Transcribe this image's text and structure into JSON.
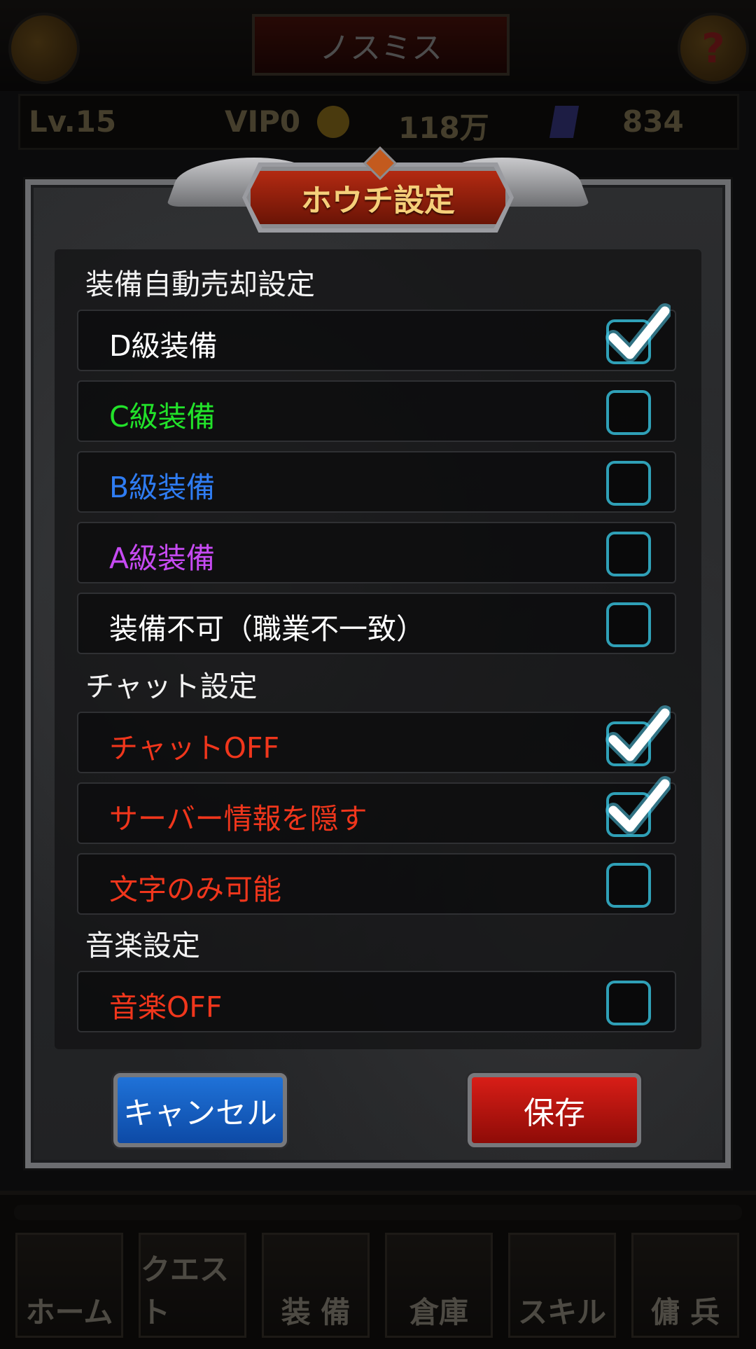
{
  "background": {
    "player_name": "ノスミス",
    "help_icon": "?",
    "level": "Lv.15",
    "vip": "VIP0",
    "gold": "118万",
    "gems": "834",
    "nav": [
      "ホーム",
      "クエスト",
      "装 備",
      "倉庫",
      "スキル",
      "傭 兵"
    ]
  },
  "dialog": {
    "title": "ホウチ設定",
    "sections": {
      "equipment": {
        "title": "装備自動売却設定",
        "rows": [
          {
            "label": "D級装備",
            "color": "#ffffff",
            "checked": true
          },
          {
            "label": "C級装備",
            "color": "#22e22a",
            "checked": false
          },
          {
            "label": "B級装備",
            "color": "#2f7cf2",
            "checked": false
          },
          {
            "label": "A級装備",
            "color": "#c64af2",
            "checked": false
          },
          {
            "label": "装備不可（職業不一致）",
            "color": "#ffffff",
            "checked": false
          }
        ]
      },
      "chat": {
        "title": "チャット設定",
        "rows": [
          {
            "label": "チャットOFF",
            "color": "#f0361c",
            "checked": true
          },
          {
            "label": "サーバー情報を隠す",
            "color": "#f0361c",
            "checked": true
          },
          {
            "label": "文字のみ可能",
            "color": "#f0361c",
            "checked": false
          }
        ]
      },
      "music": {
        "title": "音楽設定",
        "rows": [
          {
            "label": "音楽OFF",
            "color": "#f0361c",
            "checked": false
          }
        ]
      }
    },
    "buttons": {
      "cancel": "キャンセル",
      "save": "保存"
    }
  },
  "colors": {
    "checkbox_border": "#2fa0b7",
    "title_text": "#f5cf7a",
    "cancel_button": "#1f72d8",
    "save_button": "#d81e17"
  }
}
